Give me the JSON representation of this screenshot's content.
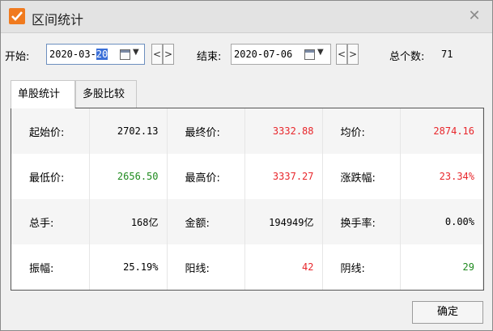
{
  "window": {
    "title": "区间统计",
    "close_glyph": "✕",
    "icon": "check-icon",
    "accent": "#f07a1e"
  },
  "toolbar": {
    "start_label": "开始:",
    "start_date_prefix": "2020-03-",
    "start_date_selected": "20",
    "end_label": "结束:",
    "end_date": "2020-07-06",
    "prev_glyph": "<",
    "next_glyph": ">",
    "total_label": "总个数:",
    "total_value": "71"
  },
  "tabs": [
    {
      "label": "单股统计",
      "active": true
    },
    {
      "label": "多股比较",
      "active": false
    }
  ],
  "stats": {
    "rows": [
      [
        {
          "k": "起始价:",
          "v": "2702.13",
          "c": ""
        },
        {
          "k": "最终价:",
          "v": "3332.88",
          "c": "red"
        },
        {
          "k": "均价:",
          "v": "2874.16",
          "c": "red"
        }
      ],
      [
        {
          "k": "最低价:",
          "v": "2656.50",
          "c": "green"
        },
        {
          "k": "最高价:",
          "v": "3337.27",
          "c": "red"
        },
        {
          "k": "涨跌幅:",
          "v": "23.34%",
          "c": "red"
        }
      ],
      [
        {
          "k": "总手:",
          "v": "168亿",
          "c": ""
        },
        {
          "k": "金额:",
          "v": "194949亿",
          "c": ""
        },
        {
          "k": "换手率:",
          "v": "0.00%",
          "c": ""
        }
      ],
      [
        {
          "k": "振幅:",
          "v": "25.19%",
          "c": ""
        },
        {
          "k": "阳线:",
          "v": "42",
          "c": "red"
        },
        {
          "k": "阴线:",
          "v": "29",
          "c": "green"
        }
      ]
    ]
  },
  "footer": {
    "ok_label": "确定"
  },
  "colors": {
    "up": "#e8262b",
    "down": "#1f8a1f"
  }
}
